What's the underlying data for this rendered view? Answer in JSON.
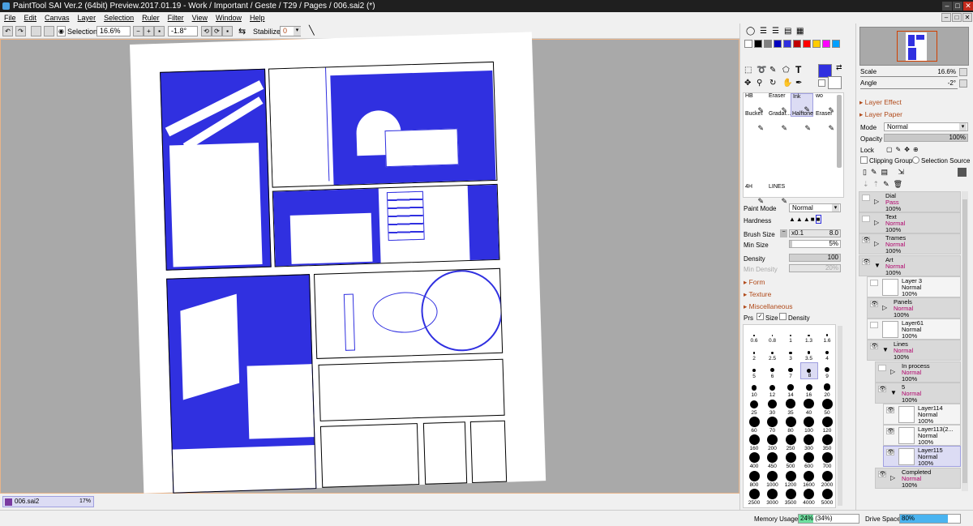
{
  "window": {
    "title": "PaintTool SAI Ver.2 (64bit) Preview.2017.01.19 - Work / Important / Geste / T29 / Pages / 006.sai2 (*)",
    "minimize": "–",
    "maximize": "□",
    "close": "✕"
  },
  "menu": [
    "File",
    "Edit",
    "Canvas",
    "Layer",
    "Selection",
    "Ruler",
    "Filter",
    "View",
    "Window",
    "Help"
  ],
  "toolbar": {
    "selection_label": "Selection",
    "zoom": "16.6%",
    "angle": "-1.8°",
    "stabilizer_label": "Stabilizer",
    "stabilizer_value": "0"
  },
  "colors": {
    "swatches": [
      "#ffffff",
      "#000000",
      "#808080",
      "#0000c0",
      "#3030e0",
      "#c00000",
      "#ff0000",
      "#ffcc00",
      "#ff00ff",
      "#00a0ff"
    ],
    "primary": "#3030e0",
    "ink": "#3030e0",
    "accent_orange": "#b04a1a"
  },
  "tools": {
    "text_tool": "T"
  },
  "brushes": [
    {
      "name": "HB",
      "selected": false
    },
    {
      "name": "Eraser",
      "selected": false
    },
    {
      "name": "Ink",
      "selected": true
    },
    {
      "name": "wo",
      "selected": false
    },
    {
      "name": "Bucket",
      "selected": false
    },
    {
      "name": "Gradat...",
      "selected": false
    },
    {
      "name": "Halftone",
      "selected": false
    },
    {
      "name": "Eraser",
      "selected": false
    },
    {
      "name": "4H",
      "selected": false
    },
    {
      "name": "LINES",
      "selected": false
    }
  ],
  "brush_settings": {
    "paint_mode_label": "Paint Mode",
    "paint_mode": "Normal",
    "hardness_label": "Hardness",
    "brush_size_label": "Brush Size",
    "brush_size_multiplier": "x0.1",
    "brush_size": "8.0",
    "min_size_label": "Min Size",
    "min_size": "5%",
    "min_size_level": 0.05,
    "density_label": "Density",
    "density": "100",
    "min_density_label": "Min Density",
    "min_density": "20%",
    "form_label": "Form",
    "texture_label": "Texture",
    "misc_label": "Miscellaneous",
    "prs_label": "Prs",
    "size_label": "Size",
    "density_check_label": "Density"
  },
  "brush_sizes": [
    "0.6",
    "0.8",
    "1",
    "1.3",
    "1.6",
    "2",
    "2.5",
    "3",
    "3.5",
    "4",
    "5",
    "6",
    "7",
    "8",
    "9",
    "10",
    "12",
    "14",
    "16",
    "20",
    "25",
    "30",
    "35",
    "40",
    "50",
    "60",
    "70",
    "80",
    "100",
    "120",
    "160",
    "200",
    "250",
    "300",
    "350",
    "400",
    "450",
    "500",
    "600",
    "700",
    "800",
    "1000",
    "1200",
    "1600",
    "2000",
    "2500",
    "3000",
    "3500",
    "4000",
    "5000"
  ],
  "selected_brush_size": "8",
  "navigator": {
    "scale_label": "Scale",
    "scale": "16.6%",
    "angle_label": "Angle",
    "angle": "-2°"
  },
  "layer_panel": {
    "layer_effect": "Layer Effect",
    "layer_paper": "Layer Paper",
    "mode_label": "Mode",
    "mode": "Normal",
    "opacity_label": "Opacity",
    "opacity": "100%",
    "opacity_level": 1.0,
    "lock_label": "Lock",
    "clipping_group": "Clipping Group",
    "selection_source": "Selection Source"
  },
  "layers": [
    {
      "name": "Dial",
      "mode": "Pass",
      "opacity": "100%",
      "folder": true,
      "visible": false,
      "indent": 0,
      "selected": false
    },
    {
      "name": "Text",
      "mode": "Normal",
      "opacity": "100%",
      "folder": true,
      "visible": false,
      "indent": 0,
      "selected": false
    },
    {
      "name": "Trames",
      "mode": "Normal",
      "opacity": "100%",
      "folder": true,
      "visible": true,
      "indent": 0,
      "selected": false
    },
    {
      "name": "Art",
      "mode": "Normal",
      "opacity": "100%",
      "folder": true,
      "open": true,
      "visible": true,
      "indent": 0,
      "selected": false
    },
    {
      "name": "Layer 3",
      "mode": "Normal",
      "opacity": "100%",
      "folder": false,
      "visible": false,
      "indent": 1,
      "selected": false
    },
    {
      "name": "Panels",
      "mode": "Normal",
      "opacity": "100%",
      "folder": true,
      "visible": true,
      "indent": 1,
      "selected": false
    },
    {
      "name": "Layer61",
      "mode": "Normal",
      "opacity": "100%",
      "folder": false,
      "visible": false,
      "indent": 1,
      "selected": false
    },
    {
      "name": "Lines",
      "mode": "Normal",
      "opacity": "100%",
      "folder": true,
      "open": true,
      "visible": true,
      "indent": 1,
      "selected": false
    },
    {
      "name": "In process",
      "mode": "Normal",
      "opacity": "100%",
      "folder": true,
      "visible": false,
      "indent": 2,
      "selected": false
    },
    {
      "name": "5",
      "mode": "Normal",
      "opacity": "100%",
      "folder": true,
      "open": true,
      "visible": true,
      "indent": 2,
      "selected": false
    },
    {
      "name": "Layer114",
      "mode": "Normal",
      "opacity": "100%",
      "folder": false,
      "visible": true,
      "indent": 3,
      "selected": false
    },
    {
      "name": "Layer113(2...",
      "mode": "Normal",
      "opacity": "100%",
      "folder": false,
      "visible": true,
      "indent": 3,
      "selected": false
    },
    {
      "name": "Layer115",
      "mode": "Normal",
      "opacity": "100%",
      "folder": false,
      "visible": true,
      "indent": 3,
      "selected": true
    },
    {
      "name": "Completed",
      "mode": "Normal",
      "opacity": "100%",
      "folder": true,
      "visible": true,
      "indent": 2,
      "selected": false
    }
  ],
  "document_tab": {
    "name": "006.sai2",
    "zoom": "17%"
  },
  "status": {
    "memory_label": "Memory Usage",
    "memory_value": "24% (34%)",
    "memory_level": 0.24,
    "drive_label": "Drive Space",
    "drive_value": "80%",
    "drive_level": 0.8
  }
}
